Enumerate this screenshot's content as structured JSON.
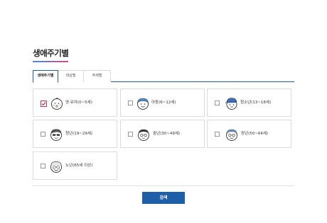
{
  "page": {
    "title": "생애주기별"
  },
  "tabs": [
    {
      "label": "생애주기별",
      "active": true
    },
    {
      "label": "대상별",
      "active": false
    },
    {
      "label": "주제별",
      "active": false
    }
  ],
  "options": [
    {
      "label": "영·유아(0~5세)",
      "checked": true,
      "icon": "baby-face-icon"
    },
    {
      "label": "아동(6~12세)",
      "checked": false,
      "icon": "child-face-icon"
    },
    {
      "label": "청소년(13~18세)",
      "checked": false,
      "icon": "teen-face-icon"
    },
    {
      "label": "청년(19~29세)",
      "checked": false,
      "icon": "youth-face-icon"
    },
    {
      "label": "중년(30~49세)",
      "checked": false,
      "icon": "middle-aged-face-icon"
    },
    {
      "label": "장년(50~64세)",
      "checked": false,
      "icon": "senior-face-icon"
    },
    {
      "label": "노년(65세 이상)",
      "checked": false,
      "icon": "elderly-face-icon"
    }
  ],
  "actions": {
    "search_label": "검색"
  },
  "colors": {
    "accent": "#1f5fa8",
    "check": "#d8324a",
    "title_underline_start": "#3c8fd6",
    "title_underline_end": "#d94a86"
  }
}
